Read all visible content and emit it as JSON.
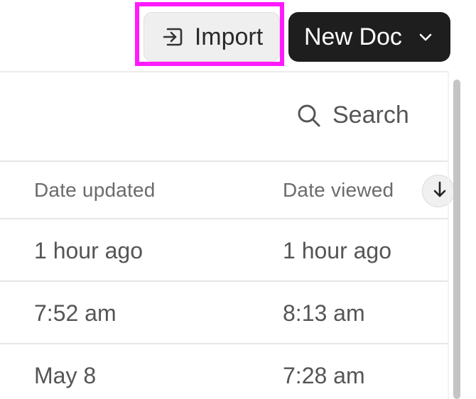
{
  "toolbar": {
    "import_label": "Import",
    "new_doc_label": "New Doc"
  },
  "search": {
    "label": "Search"
  },
  "table": {
    "columns": [
      "Date updated",
      "Date viewed"
    ],
    "rows": [
      {
        "date_updated": "1 hour ago",
        "date_viewed": "1 hour ago"
      },
      {
        "date_updated": "7:52 am",
        "date_viewed": "8:13 am"
      },
      {
        "date_updated": "May 8",
        "date_viewed": "7:28 am"
      }
    ]
  },
  "colors": {
    "highlight": "#ff1aff",
    "new_doc_bg": "#1e1e1e",
    "import_bg": "#efefef"
  },
  "icons": {
    "import": "import-icon",
    "chevron": "chevron-down-icon",
    "search": "search-icon",
    "sort": "arrow-down-icon"
  }
}
